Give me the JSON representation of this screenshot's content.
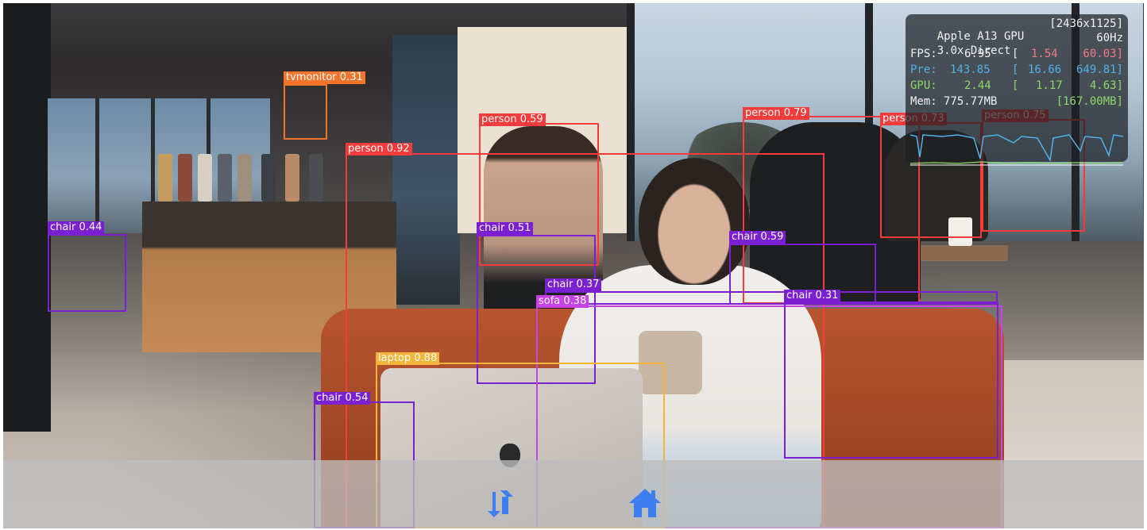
{
  "colors": {
    "person": "#f53b3b",
    "chair": "#7a1fd1",
    "sofa": "#c743e6",
    "laptop": "#f5b53b",
    "tvmonitor": "#f5742a",
    "toolbar_icon": "#3d7ef0",
    "stats_pre": "#4fb3e8",
    "stats_gpu": "#8ed96a",
    "stats_fps_range": "#f07b8a"
  },
  "detections": [
    {
      "label": "tvmonitor 0.31"
    },
    {
      "label": "person 0.59"
    },
    {
      "label": "person 0.92"
    },
    {
      "label": "person 0.79"
    },
    {
      "label": "person 0.73"
    },
    {
      "label": "person 0.75"
    },
    {
      "label": "chair 0.44"
    },
    {
      "label": "chair 0.51"
    },
    {
      "label": "chair 0.59"
    },
    {
      "label": "chair 0.37"
    },
    {
      "label": "sofa 0.38"
    },
    {
      "label": "chair 0.31"
    },
    {
      "label": "laptop 0.88"
    },
    {
      "label": "chair 0.54"
    }
  ],
  "stats": {
    "gpu_name": "Apple A13 GPU",
    "resolution": "[2436x1125]",
    "mode": "3.0x Direct",
    "refresh": "60Hz",
    "fps": {
      "label": "FPS:",
      "value": "6.95",
      "sep": "[",
      "min": "1.54",
      "max": "60.03]"
    },
    "pre": {
      "label": "Pre:",
      "value": "143.85",
      "sep": "[",
      "min": "16.66",
      "max": "649.81]"
    },
    "gpu": {
      "label": "GPU:",
      "value": "2.44",
      "sep": "[",
      "min": "1.17",
      "max": "4.63]"
    },
    "mem": {
      "label": "Mem:",
      "value": "775.77MB",
      "extra": "[167.00MB]"
    }
  },
  "toolbar": {
    "switch_icon": "switch-camera-icon",
    "home_icon": "home-icon"
  }
}
